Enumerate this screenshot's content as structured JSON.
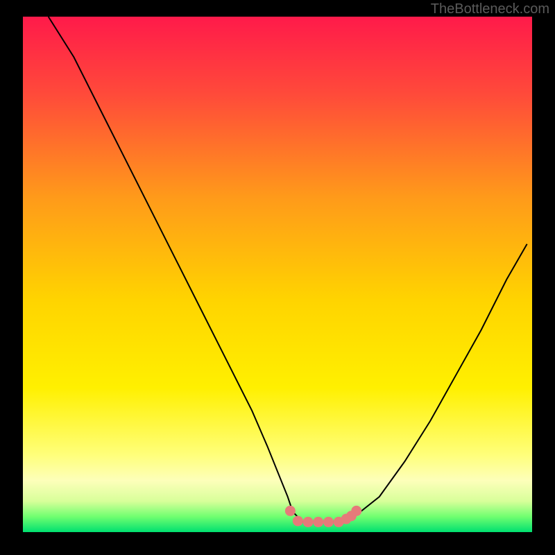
{
  "watermark": "TheBottleneck.com",
  "chart_data": {
    "type": "line",
    "title": "",
    "xlabel": "",
    "ylabel": "",
    "xlim": [
      0,
      100
    ],
    "ylim": [
      -2,
      100
    ],
    "border": {
      "left": true,
      "right": true,
      "bottom": true,
      "top": false
    },
    "series": [
      {
        "name": "bottleneck-curve",
        "color": "#000000",
        "x": [
          5,
          10,
          15,
          20,
          25,
          30,
          35,
          40,
          45,
          48,
          50,
          52,
          53,
          55,
          60,
          63,
          65,
          70,
          75,
          80,
          85,
          90,
          95,
          99
        ],
        "y": [
          100,
          92,
          82,
          72,
          62,
          52,
          42,
          32,
          22,
          15,
          10,
          5,
          2,
          0,
          0,
          0,
          1,
          5,
          12,
          20,
          29,
          38,
          48,
          55
        ]
      },
      {
        "name": "highlight-region",
        "color": "#e67a7a",
        "type": "marker",
        "x": [
          52.5,
          54,
          56,
          58,
          60,
          62,
          63.5,
          64.5,
          65.5
        ],
        "y": [
          2.2,
          0.2,
          0,
          0,
          0,
          0,
          0.6,
          1.2,
          2.2
        ]
      }
    ],
    "gradient_stops": [
      {
        "offset": 0.0,
        "color": "#ff1a4a"
      },
      {
        "offset": 0.15,
        "color": "#ff4a3a"
      },
      {
        "offset": 0.35,
        "color": "#ff9a1a"
      },
      {
        "offset": 0.55,
        "color": "#ffd400"
      },
      {
        "offset": 0.72,
        "color": "#fff000"
      },
      {
        "offset": 0.85,
        "color": "#ffff7a"
      },
      {
        "offset": 0.9,
        "color": "#fdffba"
      },
      {
        "offset": 0.94,
        "color": "#d8ff9a"
      },
      {
        "offset": 0.97,
        "color": "#70ff70"
      },
      {
        "offset": 1.0,
        "color": "#00e070"
      }
    ]
  }
}
